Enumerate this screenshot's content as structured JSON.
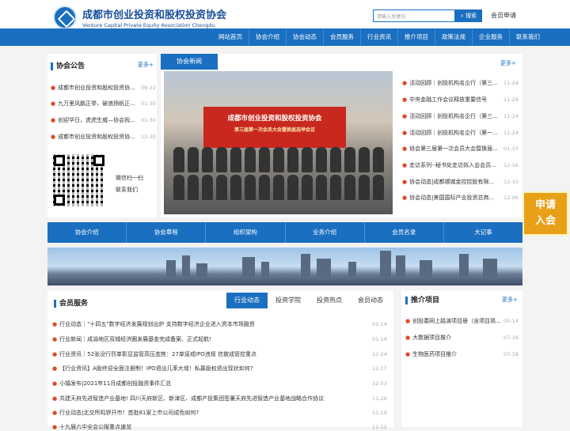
{
  "header": {
    "title_cn": "成都市创业投资和股权投资协会",
    "title_en": "Venture Capital Private Equity Association Chengdu",
    "search_placeholder": "请输入关键词",
    "search_button": "搜索",
    "member_apply": "会员申请"
  },
  "nav": [
    "网站首页",
    "协会介绍",
    "协会动态",
    "会员服务",
    "行业资讯",
    "推介项目",
    "政策法规",
    "企业服务",
    "联系我们"
  ],
  "notice": {
    "title": "协会公告",
    "more": "更多+",
    "items": [
      {
        "text": "成都市创业投资和股权投资协...",
        "date": "09-22"
      },
      {
        "text": "九万里风鹏正举，破浪扬帆正...",
        "date": "01-30"
      },
      {
        "text": "创迎华日，虎虎生威—协会祝...",
        "date": "01-30"
      },
      {
        "text": "成都市创业投资和股权投资协...",
        "date": "12-30"
      }
    ],
    "qr_text": [
      "微信扫一扫",
      "联系我们"
    ]
  },
  "news": {
    "tab": "协会新闻",
    "more": "更多+",
    "photo_banner_line1": "成都市创业投资和股权投资协会",
    "photo_banner_line2": "第三届第一次会员大会暨换届选举会议",
    "items": [
      {
        "text": "活动回顾｜创投机构名企行（第三...",
        "date": "11-24"
      },
      {
        "text": "中央金融工作会议释放重要信号",
        "date": "11-24"
      },
      {
        "text": "活动回顾｜创投机构名企行（第三...",
        "date": "11-24"
      },
      {
        "text": "活动回顾｜创投机构名企行（第一...",
        "date": "11-24"
      },
      {
        "text": "协会第三届第一次会员大会暨换届...",
        "date": "01-10"
      },
      {
        "text": "走访系列--秘书处走访拟入会会员...",
        "date": "12-16"
      },
      {
        "text": "协会动态|成都顺城金控控股有限...",
        "date": "12-10"
      },
      {
        "text": "协会动态|美国国际产业投资总商...",
        "date": "12-06"
      }
    ]
  },
  "quick_links": [
    "协会介绍",
    "协会章程",
    "组织架构",
    "业务介绍",
    "会员名录",
    "大记事"
  ],
  "apply_float": [
    "申请",
    "入会"
  ],
  "member_service": {
    "title": "会员服务",
    "tabs": [
      "行业动态",
      "投资学院",
      "投资热点",
      "会员动态"
    ],
    "items": [
      {
        "text": "行业动态｜\"十四五\"数字经济发展规划出炉 支持数字经济企业进入资本市场融资",
        "date": "01-14"
      },
      {
        "text": "行业新闻｜成渝地区双城经济圈发展基金完成备案、正式起航!",
        "date": "01-14"
      },
      {
        "text": "行业资讯｜52张没行罚单彰显监管高压态势：27单惩戒IPO违规 信披成管控重点",
        "date": "12-24"
      },
      {
        "text": "【行业资讯】A股终迎全面注册制！IPO退出几率大增！私募股权退出现状如何?",
        "date": "12-17"
      },
      {
        "text": "小镇发布|2021年11月成都创投融资事件汇总",
        "date": "12-03"
      },
      {
        "text": "共建天府先进智造产业基地! 四川天府新区、新津区、成都产投集团签署天府先进智造产业基地战略合作协议",
        "date": "11-26"
      },
      {
        "text": "行业动态|北交所鸣锣开市！首批81家上市公司成色如何?",
        "date": "11-19"
      },
      {
        "text": "十九届六中全会公报重点速览",
        "date": "11-12"
      }
    ]
  },
  "projects": {
    "title": "推介项目",
    "more": "更多+",
    "items": [
      {
        "text": "创投委网上路演项目册（含项目简...",
        "date": "05-14"
      },
      {
        "text": "大数据项目推介",
        "date": "07-18"
      },
      {
        "text": "生物医药项目推介",
        "date": "07-18"
      }
    ]
  }
}
